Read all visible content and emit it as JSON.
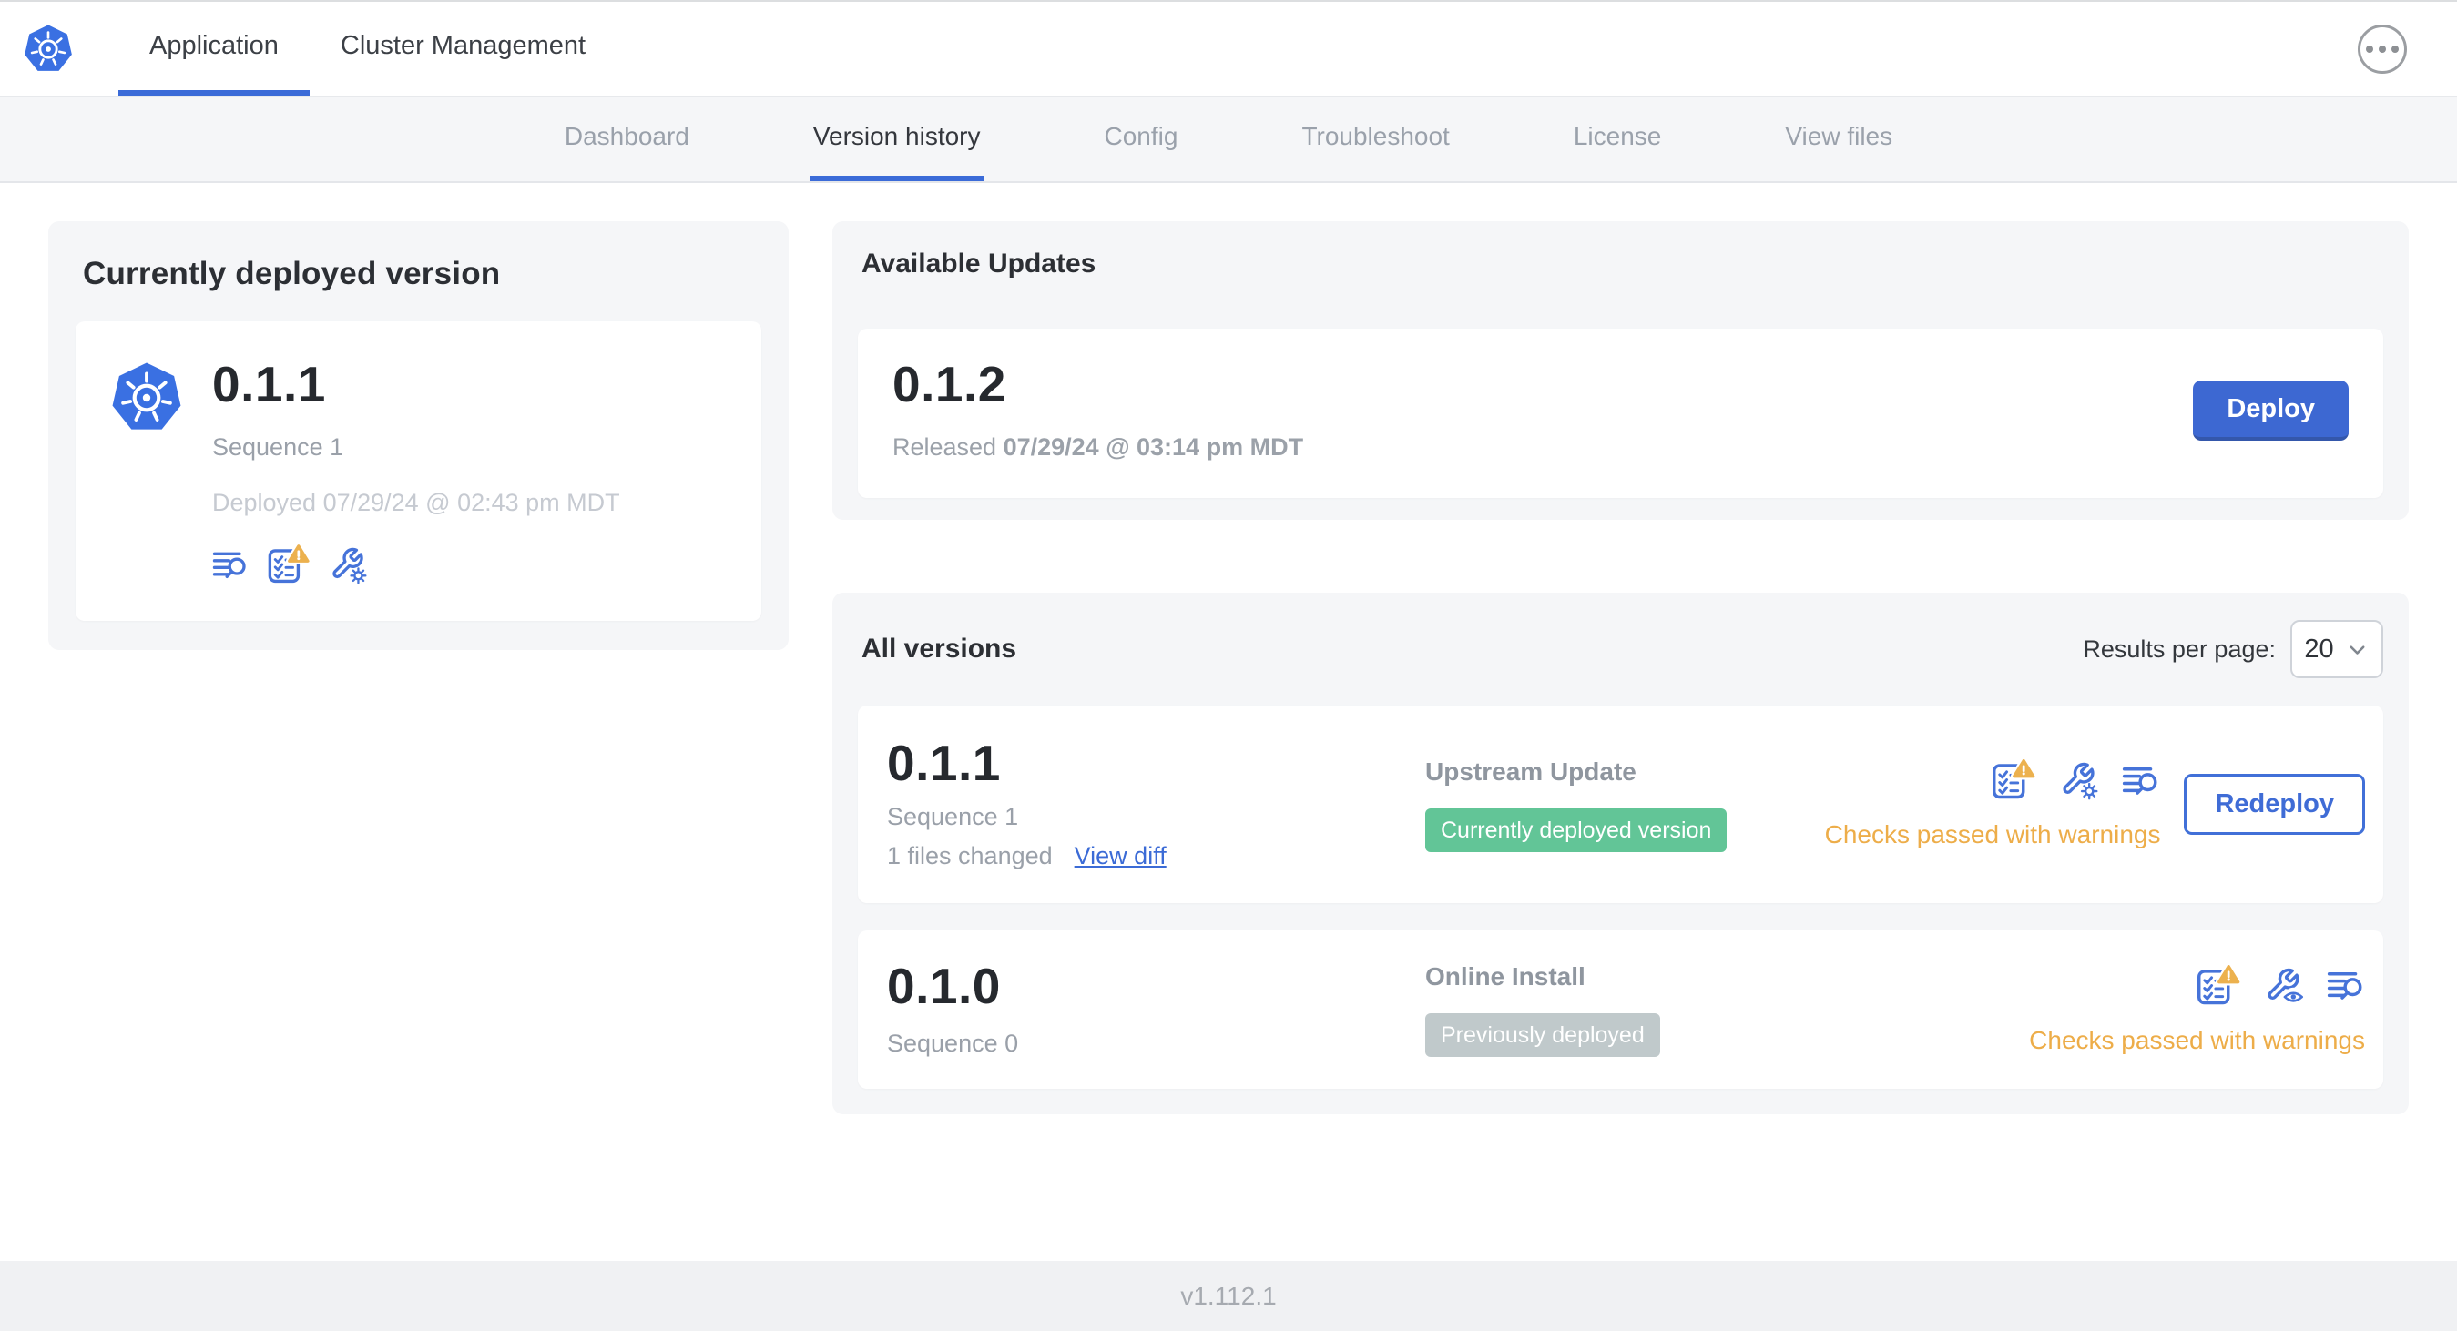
{
  "colors": {
    "accent_blue": "#3b6bd8",
    "icon_blue": "#4673d9",
    "button_blue": "#3d68d2",
    "badge_green": "#62c597",
    "badge_gray": "#c0c9cb",
    "warning_amber": "#edad49",
    "card_bg": "#f5f6f8"
  },
  "header": {
    "logo_icon": "kubernetes-logo",
    "tabs": [
      {
        "label": "Application",
        "active": true
      },
      {
        "label": "Cluster Management",
        "active": false
      }
    ],
    "menu_icon": "ellipsis-menu"
  },
  "subnav": {
    "active": "Version history",
    "items": [
      "Dashboard",
      "Version history",
      "Config",
      "Troubleshoot",
      "License",
      "View files"
    ]
  },
  "current_version_card": {
    "title": "Currently deployed version",
    "logo_icon": "kubernetes-logo",
    "version": "0.1.1",
    "sequence": "Sequence 1",
    "deployed": "Deployed 07/29/24 @ 02:43 pm MDT",
    "icons": [
      "diff-icon",
      "preflight-checks-warning-icon",
      "edit-config-icon"
    ]
  },
  "available_updates": {
    "title": "Available Updates",
    "version": "0.1.2",
    "released_prefix": "Released",
    "released_date": "07/29/24 @ 03:14 pm MDT",
    "deploy_label": "Deploy"
  },
  "all_versions": {
    "title": "All versions",
    "results_per_page_label": "Results per page:",
    "results_per_page_value": "20",
    "rows": [
      {
        "version": "0.1.1",
        "sequence": "Sequence 1",
        "files_changed": "1 files changed",
        "view_diff_label": "View diff",
        "source": "Upstream Update",
        "badge_label": "Currently deployed version",
        "badge_color": "#62c597",
        "status": "Checks passed with warnings",
        "action_label": "Redeploy",
        "icons": [
          "preflight-checks-warning-icon",
          "edit-config-icon",
          "diff-icon"
        ]
      },
      {
        "version": "0.1.0",
        "sequence": "Sequence 0",
        "source": "Online Install",
        "badge_label": "Previously deployed",
        "badge_color": "#c0c9cb",
        "status": "Checks passed with warnings",
        "icons": [
          "preflight-checks-warning-icon",
          "view-config-icon",
          "diff-icon"
        ]
      }
    ]
  },
  "footer": {
    "version": "v1.112.1"
  }
}
